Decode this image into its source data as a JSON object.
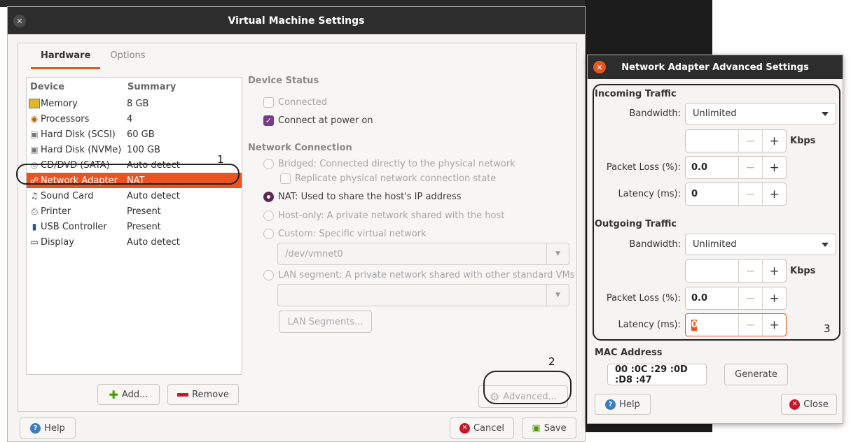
{
  "main_window": {
    "title": "Virtual Machine Settings",
    "tabs": [
      {
        "label": "Hardware"
      },
      {
        "label": "Options"
      }
    ],
    "device_list": {
      "headers": {
        "device": "Device",
        "summary": "Summary"
      },
      "rows": [
        {
          "name": "Memory",
          "summary": "8 GB",
          "icon": "memory-icon"
        },
        {
          "name": "Processors",
          "summary": "4",
          "icon": "processor-icon"
        },
        {
          "name": "Hard Disk (SCSI)",
          "summary": "60 GB",
          "icon": "hard-disk-icon"
        },
        {
          "name": "Hard Disk (NVMe)",
          "summary": "100 GB",
          "icon": "hard-disk-icon"
        },
        {
          "name": "CD/DVD (SATA)",
          "summary": "Auto detect",
          "icon": "cd-dvd-icon"
        },
        {
          "name": "Network Adapter",
          "summary": "NAT",
          "icon": "network-icon"
        },
        {
          "name": "Sound Card",
          "summary": "Auto detect",
          "icon": "sound-card-icon"
        },
        {
          "name": "Printer",
          "summary": "Present",
          "icon": "printer-icon"
        },
        {
          "name": "USB Controller",
          "summary": "Present",
          "icon": "usb-icon"
        },
        {
          "name": "Display",
          "summary": "Auto detect",
          "icon": "display-icon"
        }
      ],
      "selected": "Network Adapter"
    },
    "add_button": "Add...",
    "remove_button": "Remove",
    "device_status": {
      "title": "Device Status",
      "connected": {
        "label": "Connected",
        "checked": false
      },
      "connect_at_power_on": {
        "label": "Connect at power on",
        "checked": true
      }
    },
    "network_connection": {
      "title": "Network Connection",
      "bridged": "Bridged: Connected directly to the physical network",
      "replicate": "Replicate physical network connection state",
      "nat": "NAT: Used to share the host's IP address",
      "host_only": "Host-only: A private network shared with the host",
      "custom": "Custom: Specific virtual network",
      "custom_value": "/dev/vmnet0",
      "lan_segment": "LAN segment: A private network shared with other standard VMs",
      "lan_segments_button": "LAN Segments...",
      "selected": "nat"
    },
    "advanced_button": "Advanced...",
    "help_button": "Help",
    "cancel_button": "Cancel",
    "save_button": "Save"
  },
  "annotations": {
    "one": "1",
    "two": "2",
    "three": "3"
  },
  "advanced_dialog": {
    "title": "Network Adapter Advanced Settings",
    "incoming": {
      "title": "Incoming Traffic",
      "bandwidth_label": "Bandwidth:",
      "bandwidth_value": "Unlimited",
      "kbps_value": "",
      "kbps_unit": "Kbps",
      "packet_loss_label": "Packet Loss (%):",
      "packet_loss_value": "0.0",
      "latency_label": "Latency (ms):",
      "latency_value": "0"
    },
    "outgoing": {
      "title": "Outgoing Traffic",
      "bandwidth_label": "Bandwidth:",
      "bandwidth_value": "Unlimited",
      "kbps_value": "",
      "kbps_unit": "Kbps",
      "packet_loss_label": "Packet Loss (%):",
      "packet_loss_value": "0.0",
      "latency_label": "Latency (ms):",
      "latency_value": "0"
    },
    "mac": {
      "title": "MAC Address",
      "value": "00 :0C :29 :0D :D8 :47",
      "generate_button": "Generate"
    },
    "help_button": "Help",
    "close_button": "Close"
  },
  "colors": {
    "accent": "#e95420",
    "titlebar": "#2d2d2d",
    "check": "#7b3a8a"
  }
}
